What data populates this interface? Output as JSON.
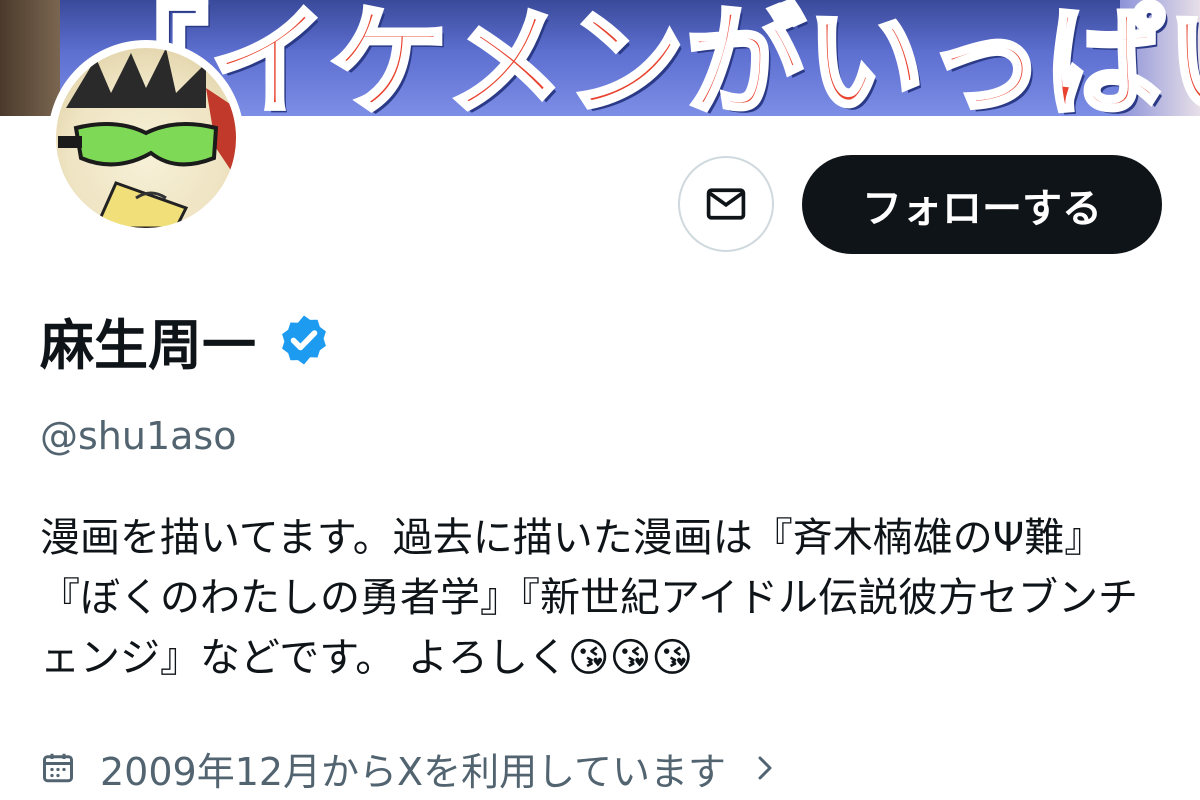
{
  "banner": {
    "text": "『イケメンがいっぱい』"
  },
  "profile": {
    "display_name": "麻生周一",
    "handle": "@shu1aso",
    "bio": "漫画を描いてます。過去に描いた漫画は『斉木楠雄のΨ難』『ぼくのわたしの勇者学』『新世紀アイドル伝説彼方セブンチェンジ』などです。 よろしく😘😘😘",
    "joined": "2009年12月からXを利用しています"
  },
  "actions": {
    "follow_label": "フォローする"
  },
  "icons": {
    "message": "envelope-icon",
    "verified": "verified-badge-icon",
    "calendar": "calendar-icon",
    "chevron": "chevron-right-icon"
  },
  "colors": {
    "verified_blue": "#1d9bf0",
    "follow_bg": "#0f1419",
    "secondary_text": "#536471"
  }
}
